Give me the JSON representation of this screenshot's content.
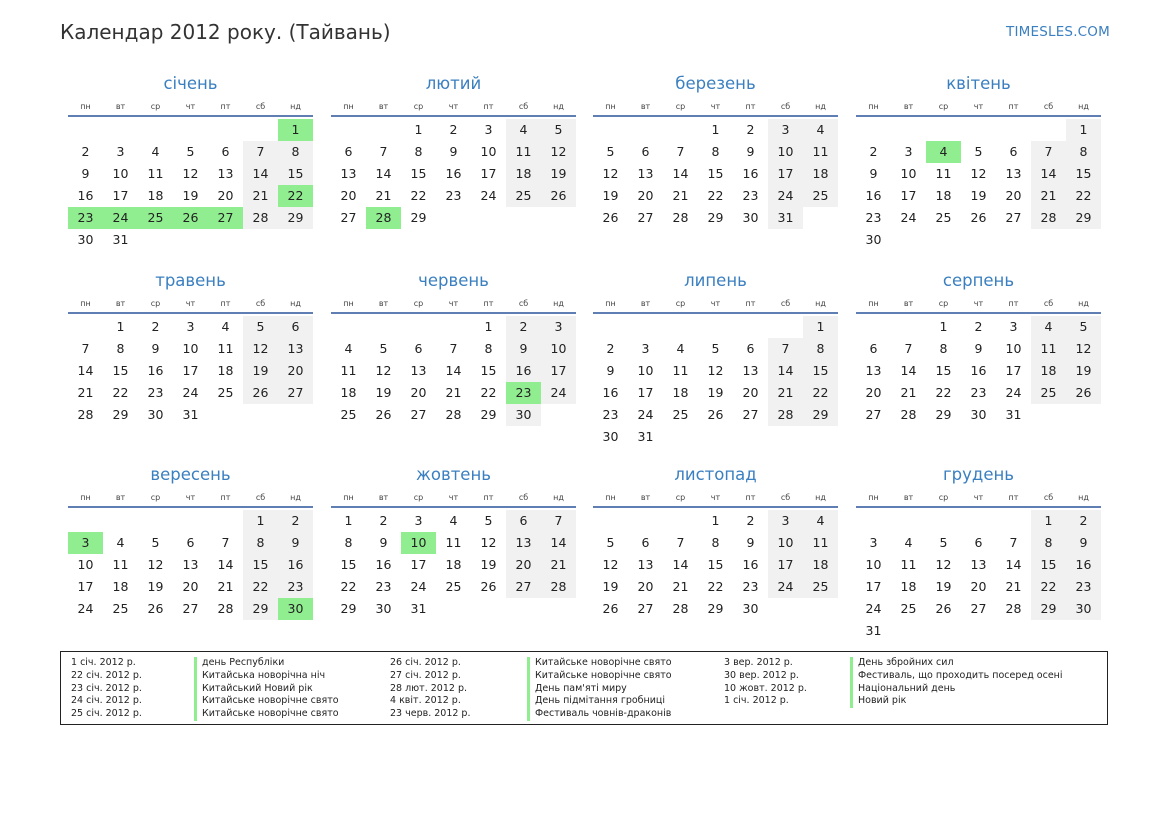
{
  "header": {
    "title": "Календар 2012 року. (Тайвань)",
    "brand": "TIMESLES.COM"
  },
  "colors": {
    "accent": "#3a7fc0",
    "holiday": "#90ee90",
    "weekend": "#f1f1f1",
    "rule": "#5f7fb4"
  },
  "weekdays": [
    "пн",
    "вт",
    "ср",
    "чт",
    "пт",
    "сб",
    "нд"
  ],
  "months": [
    {
      "name": "січень",
      "offset": 6,
      "days": 31,
      "holidays": [
        1,
        22,
        23,
        24,
        25,
        26,
        27
      ]
    },
    {
      "name": "лютий",
      "offset": 2,
      "days": 29,
      "holidays": [
        28
      ]
    },
    {
      "name": "березень",
      "offset": 3,
      "days": 31,
      "holidays": []
    },
    {
      "name": "квітень",
      "offset": 6,
      "days": 30,
      "holidays": [
        4
      ]
    },
    {
      "name": "травень",
      "offset": 1,
      "days": 31,
      "holidays": []
    },
    {
      "name": "червень",
      "offset": 4,
      "days": 30,
      "holidays": [
        23
      ]
    },
    {
      "name": "липень",
      "offset": 6,
      "days": 31,
      "holidays": []
    },
    {
      "name": "серпень",
      "offset": 2,
      "days": 31,
      "holidays": []
    },
    {
      "name": "вересень",
      "offset": 5,
      "days": 30,
      "holidays": [
        3,
        30
      ]
    },
    {
      "name": "жовтень",
      "offset": 0,
      "days": 31,
      "holidays": [
        10
      ]
    },
    {
      "name": "листопад",
      "offset": 3,
      "days": 30,
      "holidays": []
    },
    {
      "name": "грудень",
      "offset": 5,
      "days": 31,
      "holidays": []
    }
  ],
  "legend": [
    {
      "date": "1 січ. 2012 р.",
      "name": "день Республіки"
    },
    {
      "date": "22 січ. 2012 р.",
      "name": "Китайська новорічна ніч"
    },
    {
      "date": "23 січ. 2012 р.",
      "name": "Китайський Новий рік"
    },
    {
      "date": "24 січ. 2012 р.",
      "name": "Китайське новорічне свято"
    },
    {
      "date": "25 січ. 2012 р.",
      "name": "Китайське новорічне свято"
    },
    {
      "date": "26 січ. 2012 р.",
      "name": "Китайське новорічне свято"
    },
    {
      "date": "27 січ. 2012 р.",
      "name": "Китайське новорічне свято"
    },
    {
      "date": "28 лют. 2012 р.",
      "name": "День пам'яті миру"
    },
    {
      "date": "4 квіт. 2012 р.",
      "name": "День підмітання гробниці"
    },
    {
      "date": "23 черв. 2012 р.",
      "name": "Фестиваль човнів-драконів"
    },
    {
      "date": "3 вер. 2012 р.",
      "name": "День збройних сил"
    },
    {
      "date": "30 вер. 2012 р.",
      "name": "Фестиваль, що проходить посеред осені"
    },
    {
      "date": "10 жовт. 2012 р.",
      "name": "Національний день"
    },
    {
      "date": "1 січ. 2012 р.",
      "name": "Новий рік"
    }
  ]
}
